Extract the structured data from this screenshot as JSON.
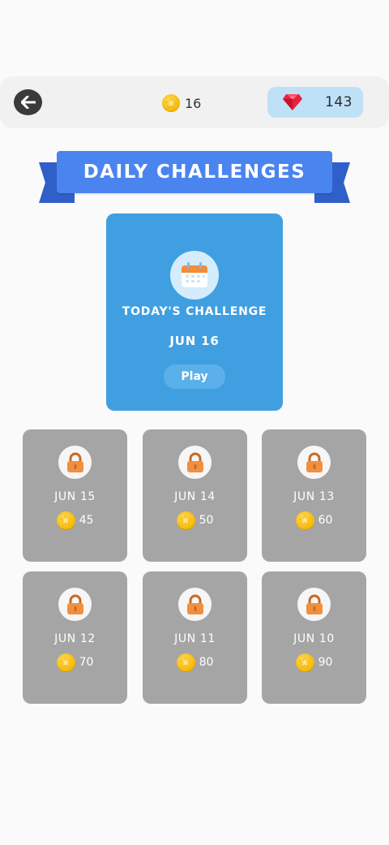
{
  "header": {
    "coins": "16",
    "gems": "143"
  },
  "banner": {
    "title": "DAILY CHALLENGES"
  },
  "today": {
    "label": "TODAY'S CHALLENGE",
    "date": "JUN 16",
    "play_label": "Play"
  },
  "challenges": [
    {
      "date": "JUN 15",
      "reward": "45",
      "locked": true
    },
    {
      "date": "JUN 14",
      "reward": "50",
      "locked": true
    },
    {
      "date": "JUN 13",
      "reward": "60",
      "locked": true
    },
    {
      "date": "JUN 12",
      "reward": "70",
      "locked": true
    },
    {
      "date": "JUN 11",
      "reward": "80",
      "locked": true
    },
    {
      "date": "JUN 10",
      "reward": "90",
      "locked": true
    }
  ],
  "colors": {
    "banner_blue": "#4a84ef",
    "today_card": "#409fe1",
    "locked_tile": "#a5a5a5",
    "gem_pill": "#bfe1f7",
    "coin": "#f5b800",
    "lock": "#f0903f"
  },
  "icons": {
    "back": "back-arrow-icon",
    "coin": "star-coin-icon",
    "gem": "ruby-gem-icon",
    "calendar": "calendar-icon",
    "lock": "padlock-icon"
  }
}
